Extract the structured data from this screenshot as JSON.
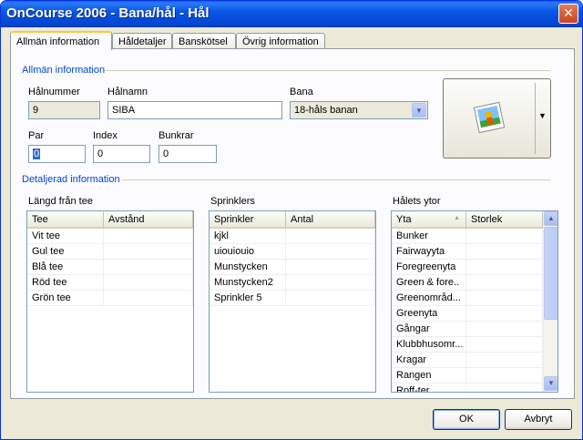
{
  "window": {
    "title": "OnCourse 2006 - Bana/hål - Hål",
    "close_glyph": "✕"
  },
  "tabs": [
    {
      "label": "Allmän information",
      "active": true
    },
    {
      "label": "Håldetaljer",
      "active": false
    },
    {
      "label": "Banskötsel",
      "active": false
    },
    {
      "label": "Övrig information",
      "active": false
    }
  ],
  "general": {
    "section_title": "Allmän information",
    "hole_number_label": "Hålnummer",
    "hole_number_value": "9",
    "hole_name_label": "Hålnamn",
    "hole_name_value": "SIBA",
    "course_label": "Bana",
    "course_value": "18-håls banan",
    "par_label": "Par",
    "par_value": "0",
    "index_label": "Index",
    "index_value": "0",
    "bunkers_label": "Bunkrar",
    "bunkers_value": "0",
    "image_button_icon": "photo-icon",
    "dropdown_glyph": "▼"
  },
  "detail": {
    "section_title": "Detaljerad information",
    "tee_group": {
      "title": "Längd från tee",
      "columns": [
        "Tee",
        "Avstånd"
      ],
      "rows": [
        [
          "Vit tee",
          ""
        ],
        [
          "Gul tee",
          ""
        ],
        [
          "Blå tee",
          ""
        ],
        [
          "Röd tee",
          ""
        ],
        [
          "Grön tee",
          ""
        ]
      ]
    },
    "sprinkler_group": {
      "title": "Sprinklers",
      "columns": [
        "Sprinkler",
        "Antal"
      ],
      "rows": [
        [
          "kjkl",
          ""
        ],
        [
          "uiouiouio",
          ""
        ],
        [
          "Munstycken",
          ""
        ],
        [
          "Munstycken2",
          ""
        ],
        [
          "Sprinkler 5",
          ""
        ]
      ]
    },
    "surface_group": {
      "title": "Hålets ytor",
      "columns": [
        "Yta",
        "Storlek"
      ],
      "sort_glyph": "▲",
      "rows": [
        [
          "Bunker",
          ""
        ],
        [
          "Fairwayyta",
          ""
        ],
        [
          "Foregreenyta",
          ""
        ],
        [
          "Green & fore..",
          ""
        ],
        [
          "Greenområd...",
          ""
        ],
        [
          "Greenyta",
          ""
        ],
        [
          "Gångar",
          ""
        ],
        [
          "Klubbhusomr...",
          ""
        ],
        [
          "Kragar",
          ""
        ],
        [
          "Rangen",
          ""
        ],
        [
          "Roff-ter",
          ""
        ]
      ],
      "scroll_up_glyph": "▲",
      "scroll_down_glyph": "▼"
    }
  },
  "footer": {
    "ok_label": "OK",
    "cancel_label": "Avbryt"
  },
  "colors": {
    "title_bar": "#0a55e6",
    "section_title": "#0046d5",
    "active_tab_highlight": "#ffc83c",
    "face": "#ece9d8"
  }
}
